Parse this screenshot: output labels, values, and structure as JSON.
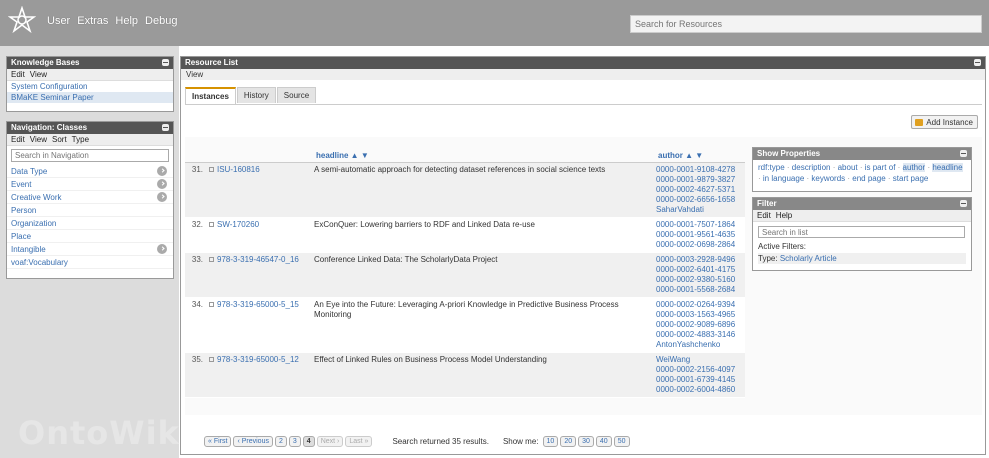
{
  "topbar": {
    "menu": [
      "User",
      "Extras",
      "Help",
      "Debug"
    ],
    "search_placeholder": "Search for Resources"
  },
  "watermark": "OntoWiki",
  "knowledge_bases": {
    "title": "Knowledge Bases",
    "menu": [
      "Edit",
      "View"
    ],
    "items": [
      "System Configuration",
      "BMaKE Seminar Paper"
    ]
  },
  "navigation": {
    "title": "Navigation: Classes",
    "menu": [
      "Edit",
      "View",
      "Sort",
      "Type"
    ],
    "search_placeholder": "Search in Navigation",
    "items": [
      "Data Type",
      "Event",
      "Creative Work",
      "Person",
      "Organization",
      "Place",
      "Intangible",
      "voaf:Vocabulary"
    ]
  },
  "resource_list": {
    "title": "Resource List",
    "view_label": "View",
    "tabs": [
      "Instances",
      "History",
      "Source"
    ],
    "add_button": "Add Instance",
    "columns": {
      "headline": "headline ▲ ▼",
      "author": "author ▲ ▼"
    },
    "rows": [
      {
        "num": "31.",
        "id": "ISU-160816",
        "headline": "A semi-automatic approach for detecting dataset references in social science texts",
        "authors": [
          "0000-0001-9108-4278",
          "0000-0001-9879-3827",
          "0000-0002-4627-5371",
          "0000-0002-6656-1658",
          "SaharVahdati"
        ]
      },
      {
        "num": "32.",
        "id": "SW-170260",
        "headline": "ExConQuer: Lowering barriers to RDF and Linked Data re-use",
        "authors": [
          "0000-0001-7507-1864",
          "0000-0001-9561-4635",
          "0000-0002-0698-2864"
        ]
      },
      {
        "num": "33.",
        "id": "978-3-319-46547-0_16",
        "headline": "Conference Linked Data: The ScholarlyData Project",
        "authors": [
          "0000-0003-2928-9496",
          "0000-0002-6401-4175",
          "0000-0002-9380-5160",
          "0000-0001-5568-2684"
        ]
      },
      {
        "num": "34.",
        "id": "978-3-319-65000-5_15",
        "headline": "An Eye into the Future: Leveraging A-priori Knowledge in Predictive Business Process Monitoring",
        "authors": [
          "0000-0002-0264-9394",
          "0000-0003-1563-4965",
          "0000-0002-9089-6896",
          "0000-0002-4883-3146",
          "AntonYashchenko"
        ]
      },
      {
        "num": "35.",
        "id": "978-3-319-65000-5_12",
        "headline": "Effect of Linked Rules on Business Process Model Understanding",
        "authors": [
          "WeiWang",
          "0000-0002-2156-4097",
          "0000-0001-6739-4145",
          "0000-0002-6004-4860"
        ]
      }
    ]
  },
  "show_properties": {
    "title": "Show Properties",
    "items": [
      "rdf:type",
      "description",
      "about",
      "is part of",
      "author",
      "headline",
      "in language",
      "keywords",
      "end page",
      "start page"
    ],
    "highlighted": [
      "author",
      "headline"
    ]
  },
  "filter": {
    "title": "Filter",
    "menu": [
      "Edit",
      "Help"
    ],
    "search_placeholder": "Search in list",
    "active_label": "Active Filters:",
    "type_label": "Type:",
    "type_value": "Scholarly Article"
  },
  "pager": {
    "first": "« First",
    "previous": "‹ Previous",
    "pages": [
      "2",
      "3",
      "4"
    ],
    "current_page": "4",
    "next": "Next ›",
    "last": "Last »",
    "info": "Search returned 35 results.",
    "show_me": "Show me:",
    "sizes": [
      "10",
      "20",
      "30",
      "40",
      "50"
    ]
  }
}
